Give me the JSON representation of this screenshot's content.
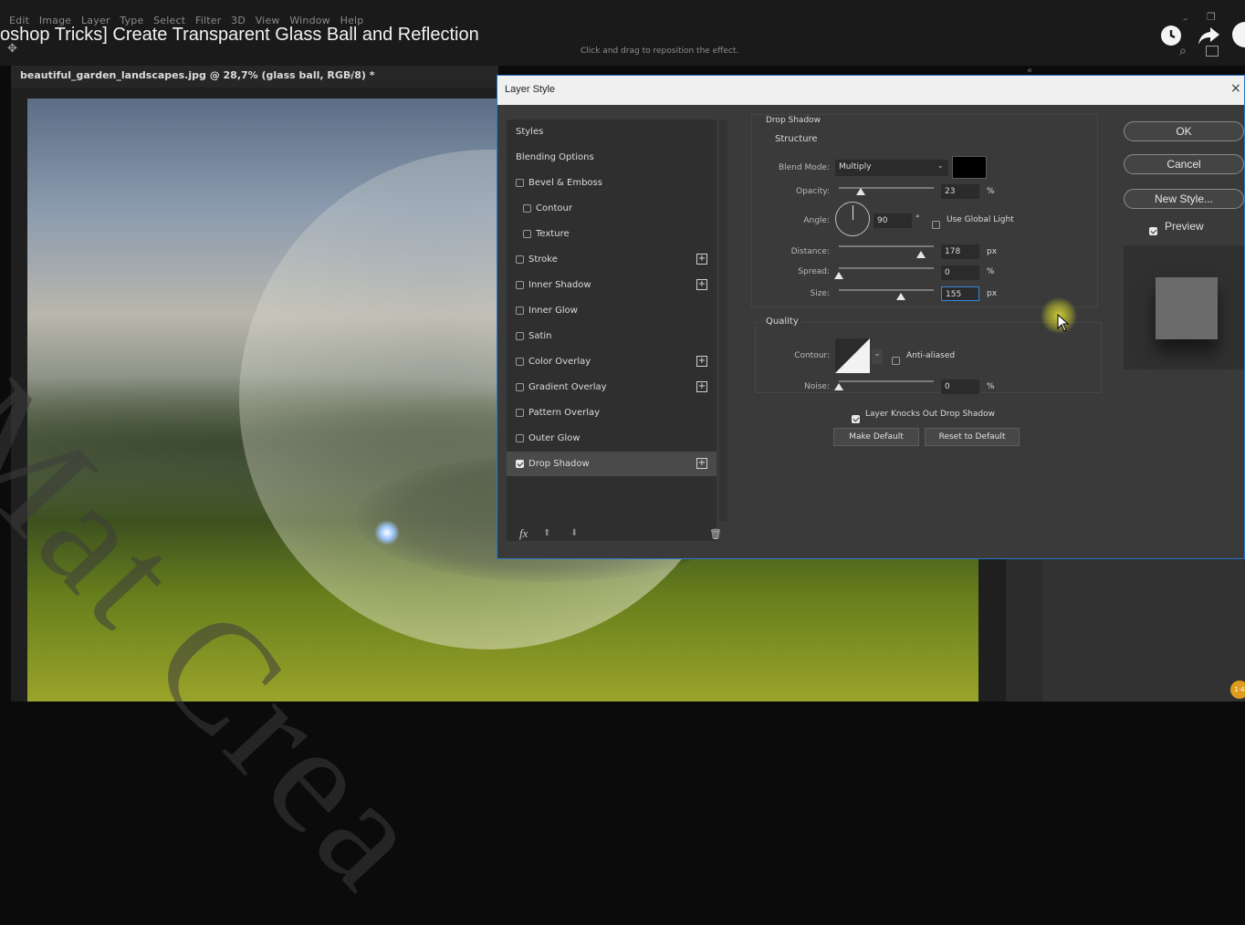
{
  "menubar": {
    "items": [
      "Edit",
      "Image",
      "Layer",
      "Type",
      "Select",
      "Filter",
      "3D",
      "View",
      "Window",
      "Help"
    ]
  },
  "video": {
    "title": "oshop Tricks] Create Transparent Glass Ball and Reflection"
  },
  "options_bar": {
    "hint": "Click and drag to reposition the effect."
  },
  "document": {
    "tab_label": "beautiful_garden_landscapes.jpg @ 28,7% (glass ball, RGB/8) *",
    "tab_close": "×"
  },
  "dialog": {
    "title": "Layer Style",
    "close": "×",
    "styles_list": [
      {
        "label": "Styles",
        "kind": "head"
      },
      {
        "label": "Blending Options",
        "kind": "head"
      },
      {
        "label": "Bevel & Emboss",
        "kind": "check",
        "checked": false,
        "plus": false
      },
      {
        "label": "Contour",
        "kind": "sub",
        "checked": false,
        "plus": false
      },
      {
        "label": "Texture",
        "kind": "sub",
        "checked": false,
        "plus": false
      },
      {
        "label": "Stroke",
        "kind": "check",
        "checked": false,
        "plus": true
      },
      {
        "label": "Inner Shadow",
        "kind": "check",
        "checked": false,
        "plus": true
      },
      {
        "label": "Inner Glow",
        "kind": "check",
        "checked": false,
        "plus": false
      },
      {
        "label": "Satin",
        "kind": "check",
        "checked": false,
        "plus": false
      },
      {
        "label": "Color Overlay",
        "kind": "check",
        "checked": false,
        "plus": true
      },
      {
        "label": "Gradient Overlay",
        "kind": "check",
        "checked": false,
        "plus": true
      },
      {
        "label": "Pattern Overlay",
        "kind": "check",
        "checked": false,
        "plus": false
      },
      {
        "label": "Outer Glow",
        "kind": "check",
        "checked": false,
        "plus": false
      },
      {
        "label": "Drop Shadow",
        "kind": "check",
        "checked": true,
        "plus": true,
        "active": true
      }
    ],
    "plus_symbol": "+",
    "bottom_icons": {
      "fx": "fx",
      "up": "⬆",
      "down": "⬇",
      "trash": "🗑"
    },
    "drop_shadow": {
      "section_title": "Drop Shadow",
      "structure_title": "Structure",
      "blend_mode_label": "Blend Mode:",
      "blend_mode_value": "Multiply",
      "shadow_color": "#000000",
      "opacity_label": "Opacity:",
      "opacity_value": "23",
      "opacity_unit": "%",
      "opacity_level": 0.23,
      "angle_label": "Angle:",
      "angle_value": "90",
      "angle_unit": "°",
      "use_global_light_label": "Use Global Light",
      "use_global_light_checked": false,
      "distance_label": "Distance:",
      "distance_value": "178",
      "distance_unit": "px",
      "distance_level": 0.87,
      "spread_label": "Spread:",
      "spread_value": "0",
      "spread_unit": "%",
      "spread_level": 0.0,
      "size_label": "Size:",
      "size_value": "155",
      "size_unit": "px",
      "size_level": 0.65,
      "quality_title": "Quality",
      "contour_label": "Contour:",
      "anti_aliased_label": "Anti-aliased",
      "anti_aliased_checked": false,
      "noise_label": "Noise:",
      "noise_value": "0",
      "noise_unit": "%",
      "noise_level": 0.0,
      "knock_out_label": "Layer Knocks Out Drop Shadow",
      "knock_out_checked": true,
      "make_default_label": "Make Default",
      "reset_default_label": "Reset to Default"
    },
    "buttons": {
      "ok": "OK",
      "cancel": "Cancel",
      "new_style": "New Style..."
    },
    "preview_label": "Preview",
    "preview_checked": true
  },
  "panel": {
    "collapse": "«"
  },
  "watermark": {
    "text": "Mat Crea"
  },
  "badge": {
    "text": "1·4"
  },
  "colors": {
    "dialog_border": "#2a78c8",
    "accent": "#e09a1e"
  }
}
